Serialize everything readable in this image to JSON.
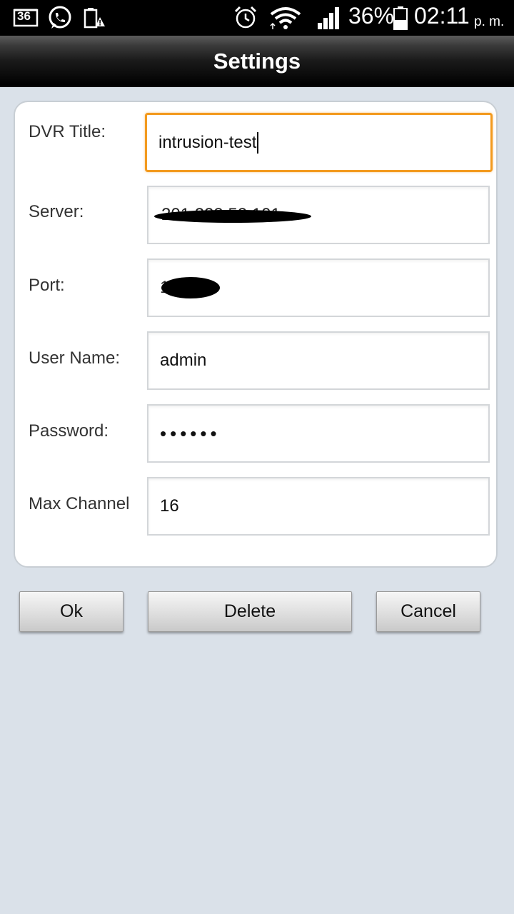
{
  "status_bar": {
    "notification_badge": "36",
    "battery_percent": "36%",
    "time": "02:11",
    "ampm": "p. m."
  },
  "header": {
    "title": "Settings"
  },
  "form": {
    "dvr_title": {
      "label": "DVR Title:",
      "value": "intrusion-test"
    },
    "server": {
      "label": "Server:",
      "value": "201.223.52.101"
    },
    "port": {
      "label": "Port:",
      "value": "16102"
    },
    "user_name": {
      "label": "User Name:",
      "value": "admin"
    },
    "password": {
      "label": "Password:",
      "value": "••••••"
    },
    "max_channel": {
      "label": "Max Channel",
      "value": "16"
    }
  },
  "buttons": {
    "ok": "Ok",
    "delete": "Delete",
    "cancel": "Cancel"
  },
  "colors": {
    "focus_border": "#f39a1e",
    "background": "#dae1e9"
  }
}
